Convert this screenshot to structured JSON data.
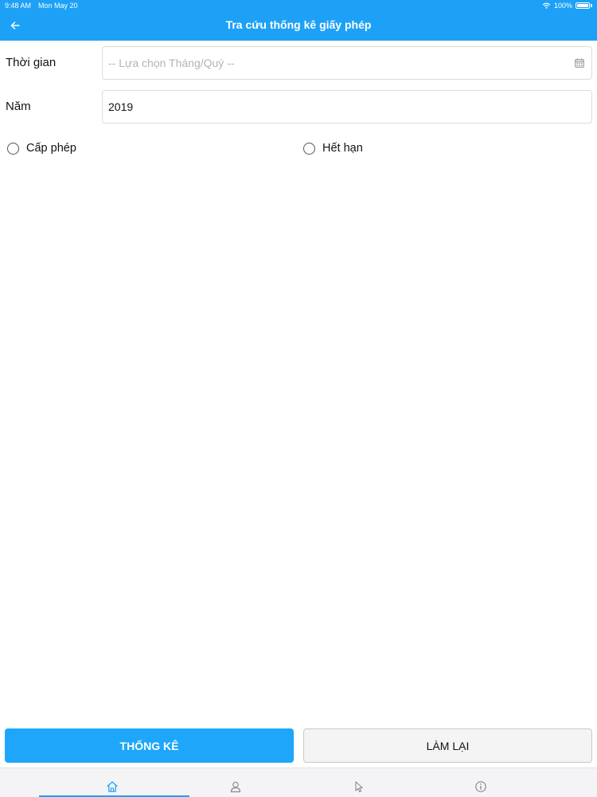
{
  "status_bar": {
    "time": "9:48 AM",
    "date": "Mon May 20",
    "battery": "100%"
  },
  "header": {
    "title": "Tra cứu thống kê giấy phép"
  },
  "form": {
    "period": {
      "label": "Thời gian",
      "placeholder": "-- Lựa chọn Tháng/Quý --"
    },
    "year": {
      "label": "Năm",
      "value": "2019"
    },
    "options": [
      {
        "label": "Cấp phép",
        "selected": false
      },
      {
        "label": "Hết hạn",
        "selected": false
      }
    ]
  },
  "actions": {
    "statistics_label": "THỐNG KÊ",
    "reset_label": "LÀM LẠI"
  },
  "tab_bar": {
    "tabs": [
      {
        "icon": "home-icon",
        "active": true
      },
      {
        "icon": "user-icon",
        "active": false
      },
      {
        "icon": "pointer-icon",
        "active": false
      },
      {
        "icon": "info-icon",
        "active": false
      }
    ]
  },
  "colors": {
    "accent": "#1da1f7",
    "primary_button": "#1ea7fa",
    "secondary_button": "#f4f4f4"
  }
}
